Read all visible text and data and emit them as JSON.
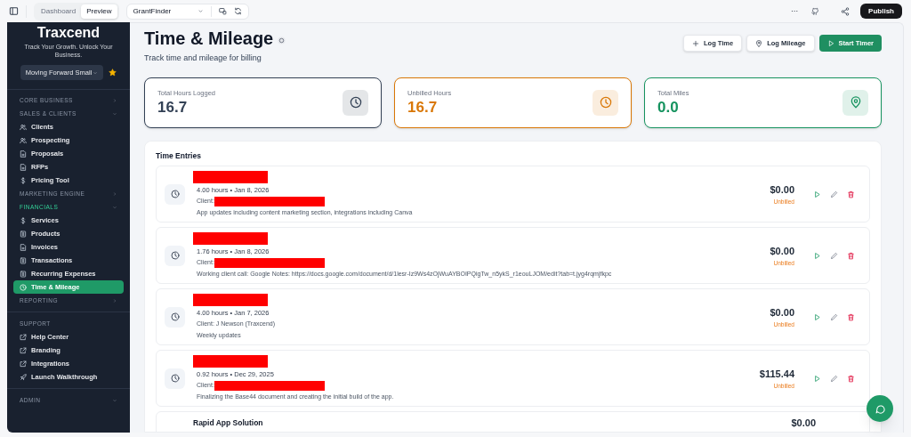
{
  "topbar": {
    "tabs": [
      {
        "label": "Dashboard",
        "selected": false
      },
      {
        "label": "Preview",
        "selected": true
      }
    ],
    "project": "GrantFinder",
    "more": "···",
    "publish": "Publish"
  },
  "sidebar": {
    "brand": "Traxcend",
    "tagline": "Track Your Growth. Unlock Your Business.",
    "workspace": "Moving Forward Small",
    "favorite": true,
    "sections": [
      {
        "label": "CORE BUSINESS",
        "expanded": false,
        "active": false
      },
      {
        "label": "SALES & CLIENTS",
        "expanded": true,
        "active": false,
        "items": [
          {
            "label": "Clients",
            "kind": "users",
            "selected": false
          },
          {
            "label": "Prospecting",
            "kind": "users",
            "selected": false
          },
          {
            "label": "Proposals",
            "kind": "doc",
            "selected": false
          },
          {
            "label": "RFPs",
            "kind": "doc",
            "selected": false
          },
          {
            "label": "Pricing Tool",
            "kind": "dollar",
            "selected": false
          }
        ]
      },
      {
        "label": "MARKETING ENGINE",
        "expanded": false,
        "active": false
      },
      {
        "label": "FINANCIALS",
        "expanded": true,
        "active": true,
        "items": [
          {
            "label": "Services",
            "kind": "dollar",
            "selected": false
          },
          {
            "label": "Products",
            "kind": "box",
            "selected": false
          },
          {
            "label": "Invoices",
            "kind": "doc",
            "selected": false
          },
          {
            "label": "Transactions",
            "kind": "box",
            "selected": false
          },
          {
            "label": "Recurring Expenses",
            "kind": "box",
            "selected": false
          },
          {
            "label": "Time & Mileage",
            "kind": "clock",
            "selected": true
          }
        ]
      },
      {
        "label": "REPORTING",
        "expanded": false,
        "active": false
      }
    ],
    "support": {
      "label": "SUPPORT",
      "items": [
        {
          "label": "Help Center",
          "kind": "external",
          "selected": false
        },
        {
          "label": "Branding",
          "kind": "external",
          "selected": false
        },
        {
          "label": "Integrations",
          "kind": "external",
          "selected": false
        },
        {
          "label": "Launch Walkthrough",
          "kind": "rocket",
          "selected": false
        }
      ]
    },
    "admin": {
      "label": "ADMIN"
    }
  },
  "page": {
    "title": "Time & Mileage",
    "subtitle": "Track time and mileage for billing",
    "actions": [
      {
        "label": "Log Time",
        "kind": "plus"
      },
      {
        "label": "Log Mileage",
        "kind": "pin"
      },
      {
        "label": "Start Timer",
        "kind": "play"
      }
    ]
  },
  "stats": [
    {
      "label": "Total Hours Logged",
      "value": "16.7",
      "color": "#334155",
      "kind": "clock"
    },
    {
      "label": "Unbilled Hours",
      "value": "16.7",
      "color": "#d97706",
      "kind": "clock"
    },
    {
      "label": "Total Miles",
      "value": "0.0",
      "color": "#16935f",
      "kind": "pin"
    }
  ],
  "entries_title": "Time Entries",
  "entries": [
    {
      "title_redacted": true,
      "meta": "4.00 hours • Jan 8, 2026",
      "client": "Client:",
      "client_redacted": true,
      "note": "App updates including content marketing section, integrations including Canva",
      "amount": "$0.00",
      "status": "Unbilled"
    },
    {
      "title_redacted": true,
      "meta": "1.76 hours • Jan 8, 2026",
      "client": "Client:",
      "client_redacted": true,
      "note": "Working client call: Google Notes: https://docs.google.com/document/d/1lesr-Iz9Ws4zOjWuAYBOIPQigTw_n5ykS_r1eouLJOM/edit?tab=t.jyg4rqmjfkpc",
      "amount": "$0.00",
      "status": "Unbilled"
    },
    {
      "title_redacted": true,
      "meta": "4.00 hours • Jan 7, 2026",
      "client": "Client: J Newson (Traxcend)",
      "client_redacted": false,
      "note": "Weekly updates",
      "amount": "$0.00",
      "status": "Unbilled"
    },
    {
      "title_redacted": true,
      "meta": "0.92 hours • Dec 29, 2025",
      "client": "Client:",
      "client_redacted": true,
      "note": "Finalizing the Base44 document and creating the initial build of the app.",
      "amount": "$115.44",
      "status": "Unbilled"
    },
    {
      "title": "Rapid App Solution",
      "title_redacted": false,
      "amount": "$0.00"
    }
  ]
}
